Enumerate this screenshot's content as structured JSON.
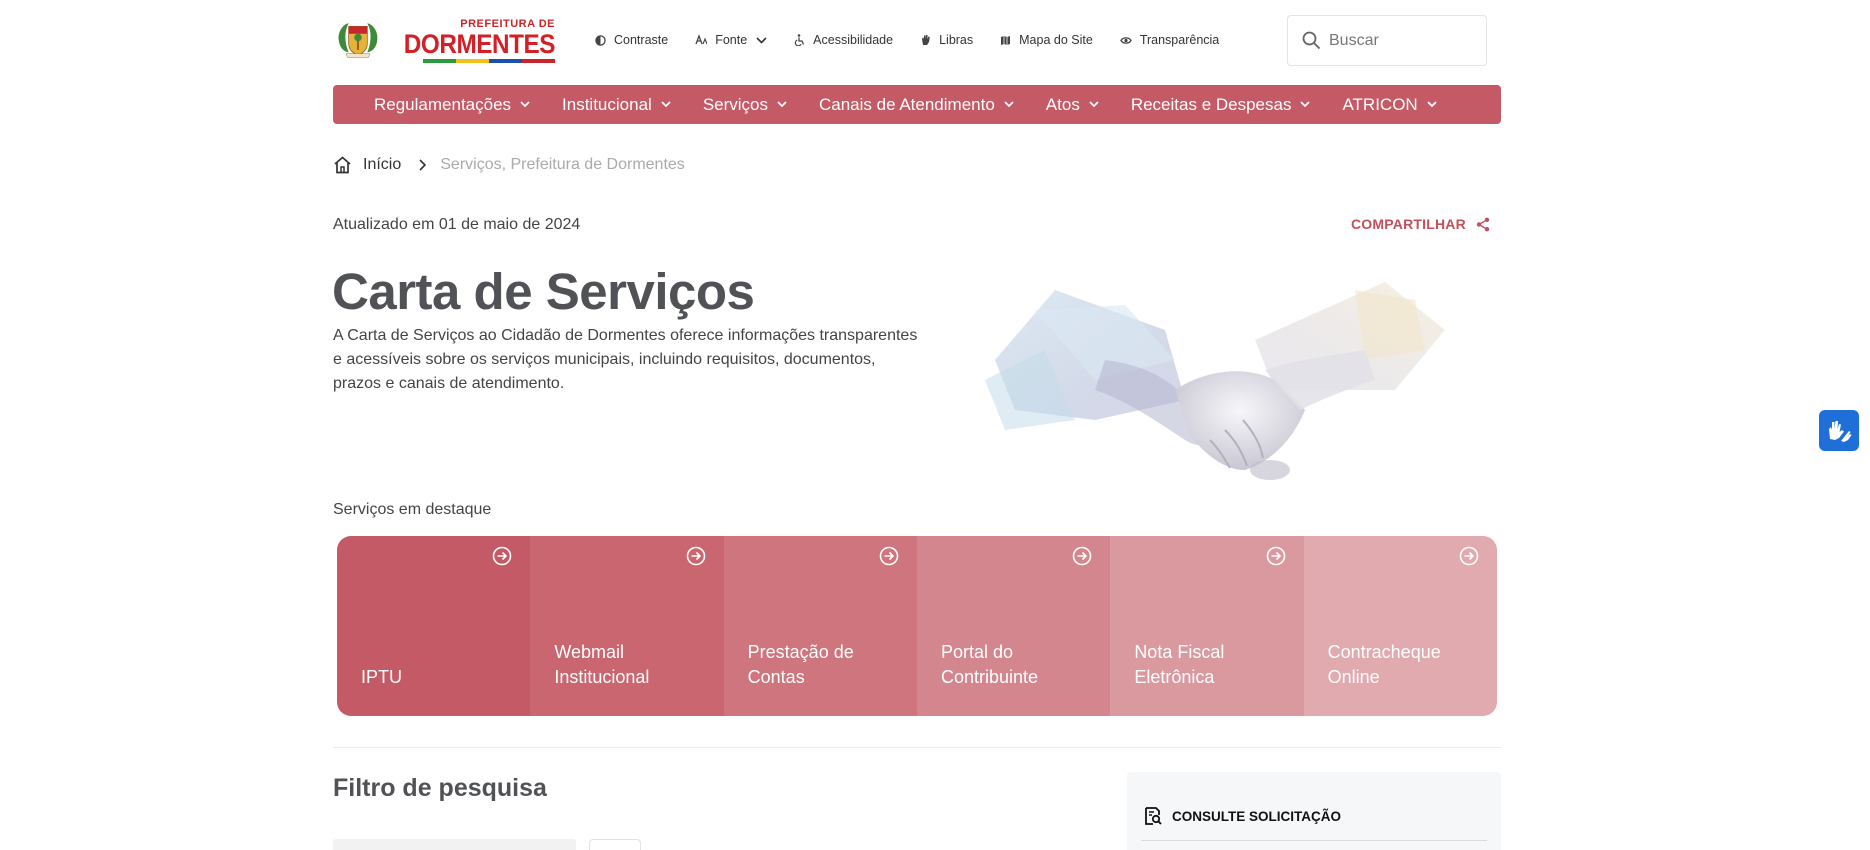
{
  "logo": {
    "line_small": "PREFEITURA DE",
    "line_big": "DORMENTES"
  },
  "toolbar": {
    "contrast": "Contraste",
    "font": "Fonte",
    "accessibility": "Acessibilidade",
    "libras": "Libras",
    "sitemap": "Mapa do Site",
    "transparency": "Transparência"
  },
  "search": {
    "placeholder": "Buscar"
  },
  "nav": {
    "items": [
      {
        "label": "Regulamentações"
      },
      {
        "label": "Institucional"
      },
      {
        "label": "Serviços"
      },
      {
        "label": "Canais de Atendimento"
      },
      {
        "label": "Atos"
      },
      {
        "label": "Receitas e Despesas"
      },
      {
        "label": "ATRICON"
      }
    ]
  },
  "breadcrumb": {
    "home": "Início",
    "current": "Serviços, Prefeitura de Dormentes"
  },
  "page": {
    "updated": "Atualizado em 01 de maio de 2024",
    "share": "COMPARTILHAR",
    "title": "Carta de Serviços",
    "description": "A Carta de Serviços ao Cidadão de Dormentes oferece informações transparentes e acessíveis sobre os serviços municipais, incluindo requisitos, documentos, prazos e canais de atendimento."
  },
  "featured": {
    "label": "Serviços em destaque",
    "cards": [
      {
        "label": "IPTU",
        "color": "#c45a65"
      },
      {
        "label": "Webmail\nInstitucional",
        "color": "#c9666f"
      },
      {
        "label": "Prestação de\nContas",
        "color": "#cf757e"
      },
      {
        "label": "Portal do\nContribuinte",
        "color": "#d4868e"
      },
      {
        "label": "Nota Fiscal\nEletrônica",
        "color": "#da999f"
      },
      {
        "label": "Contracheque\nOnline",
        "color": "#e0aaaf"
      }
    ]
  },
  "filter": {
    "title": "Filtro de pesquisa"
  },
  "consult": {
    "title": "CONSULTE SOLICITAÇÃO"
  },
  "colors": {
    "brand": "#c45a65",
    "libras_button": "#1f6fd9"
  }
}
